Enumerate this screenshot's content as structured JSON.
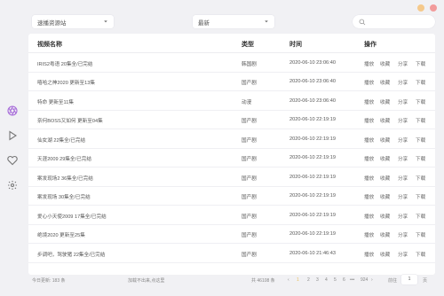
{
  "window": {
    "controls": [
      {
        "name": "minimize",
        "color": "#f5c98b"
      },
      {
        "name": "close",
        "color": "#f29b9b"
      }
    ]
  },
  "sidebar": {
    "items": [
      {
        "icon": "aperture-icon",
        "active": true,
        "color": "#a66ad9"
      },
      {
        "icon": "play-icon",
        "active": false
      },
      {
        "icon": "heart-icon",
        "active": false
      },
      {
        "icon": "gear-icon",
        "active": false
      }
    ]
  },
  "toolbar": {
    "source_select": {
      "value": "速播资源站"
    },
    "sort_select": {
      "value": "最新"
    },
    "search": {
      "placeholder": ""
    }
  },
  "table": {
    "headers": [
      "视频名称",
      "类型",
      "时间",
      "操作"
    ],
    "actions": [
      "播放",
      "收藏",
      "分享",
      "下载"
    ],
    "rows": [
      {
        "name": "IRIS2粤语 20集全/已完结",
        "type": "韩国剧",
        "time": "2020-06-10 23:06:40"
      },
      {
        "name": "嘻哈之神2020 更新至13集",
        "type": "国产剧",
        "time": "2020-06-10 23:06:40"
      },
      {
        "name": "特命 更新至11集",
        "type": "动漫",
        "time": "2020-06-10 23:06:40"
      },
      {
        "name": "奈何BOSS又如何 更新至04集",
        "type": "国产剧",
        "time": "2020-06-10 22:19:19"
      },
      {
        "name": "仙女湖 22集全/已完结",
        "type": "国产剧",
        "time": "2020-06-10 22:19:19"
      },
      {
        "name": "天涯2009 29集全/已完结",
        "type": "国产剧",
        "time": "2020-06-10 22:19:19"
      },
      {
        "name": "案发现场2 36集全/已完结",
        "type": "国产剧",
        "time": "2020-06-10 22:19:19"
      },
      {
        "name": "案发现场 30集全/已完结",
        "type": "国产剧",
        "time": "2020-06-10 22:19:19"
      },
      {
        "name": "爱心小天使2009 17集全/已完结",
        "type": "国产剧",
        "time": "2020-06-10 22:19:19"
      },
      {
        "name": "绝境2020 更新至25集",
        "type": "国产剧",
        "time": "2020-06-10 22:19:19"
      },
      {
        "name": "步调吧，驾驶猪 22集全/已完结",
        "type": "国产剧",
        "time": "2020-06-10 21:46:43"
      }
    ]
  },
  "footer": {
    "today_updates": "今日更新: 183 条",
    "notice": "加载不出来,点这里",
    "total": "共 46108 条",
    "pages": [
      "1",
      "2",
      "3",
      "4",
      "5",
      "6",
      "•••",
      "924"
    ],
    "active_page": "1",
    "jump_label": "前往",
    "jump_value": "1",
    "page_suffix": "页",
    "accent": "#e9c061"
  }
}
